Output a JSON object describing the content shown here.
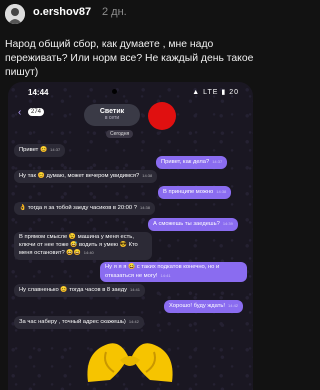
{
  "post": {
    "username": "o.ershov87",
    "age": "2 дн.",
    "text": "Народ общий сбор, как думаете , мне надо переживать? Или норм все? Не каждый день такое пишут)"
  },
  "phone": {
    "time": "14:44",
    "status_icons": "▲ LTE ▮ 20",
    "back_icon": "chevron-left-icon",
    "unread": "274",
    "chat_title": "Светик",
    "chat_subtitle": "в сети",
    "date": "Сегодня",
    "messages": [
      {
        "dir": "in",
        "text": "Привет 😊",
        "time": "14:37"
      },
      {
        "dir": "out",
        "text": "Привет, как дела?",
        "time": "14:37"
      },
      {
        "dir": "in",
        "text": "Ну так 😊 думаю, может вечером увидимся?",
        "time": "14:38"
      },
      {
        "dir": "out",
        "text": "В принципе можно",
        "time": "14:38"
      },
      {
        "dir": "in",
        "text": "👌 тогда я за тобой заеду часиков в 20:00 ?",
        "time": "14:38"
      },
      {
        "dir": "out",
        "text": "А сможешь ты заедешь?",
        "time": "14:39"
      },
      {
        "dir": "in",
        "text": "В прямом смысле 😉 машина у меня есть, ключи от нее тоже 😅 водить я умею 😎 Кто меня остановит? 😄😄",
        "time": "14:40"
      },
      {
        "dir": "out",
        "text": "Ну я я я 😅 с таких подкатов конечно, но и отказаться не могу!",
        "time": "14:41"
      },
      {
        "dir": "in",
        "text": "Ну славненько 😊 тогда часов в 8 заеду",
        "time": "14:41"
      },
      {
        "dir": "out",
        "text": "Хорошо! буду ждать!",
        "time": "14:42"
      },
      {
        "dir": "in",
        "text": "За час наберу , точный адрес скажешь)",
        "time": "14:42"
      }
    ],
    "sticker": "heart-hands-sticker"
  }
}
